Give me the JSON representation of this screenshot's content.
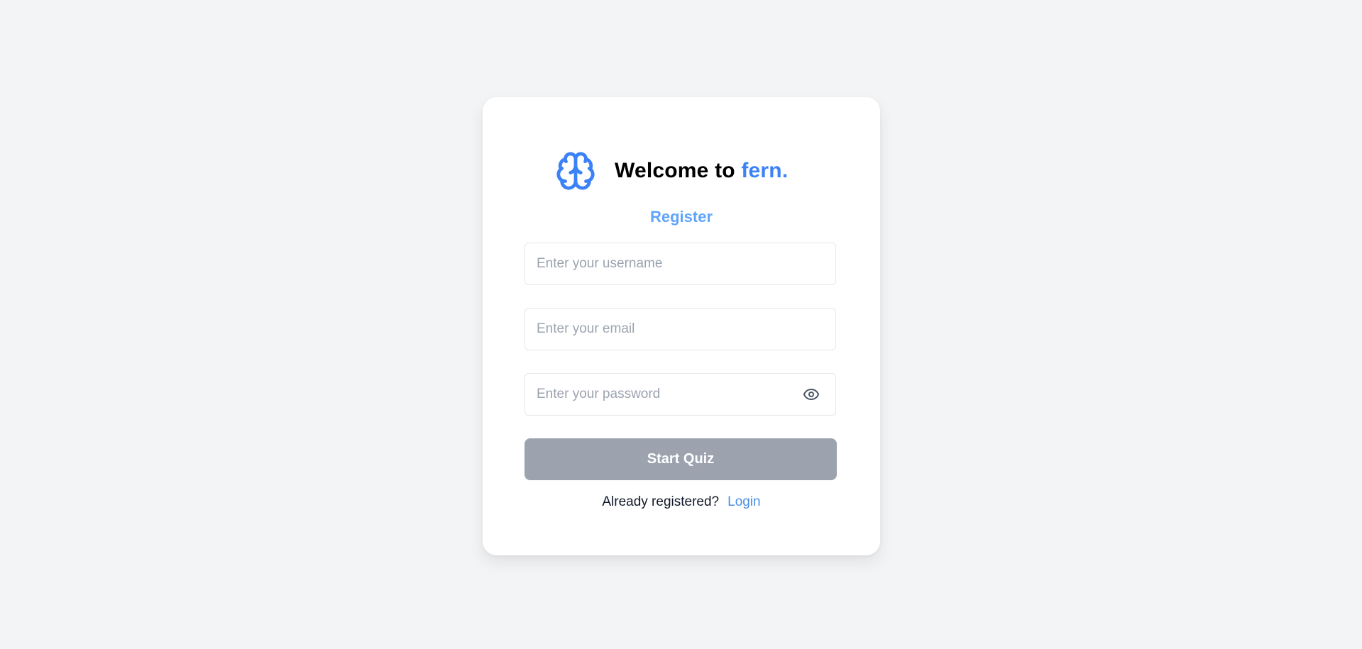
{
  "brand": {
    "welcome_prefix": "Welcome to ",
    "name": "fern.",
    "logo_icon": "brain-icon",
    "accent_color": "#3b82f6"
  },
  "form": {
    "title": "Register",
    "username_placeholder": "Enter your username",
    "email_placeholder": "Enter your email",
    "password_placeholder": "Enter your password",
    "password_toggle_icon": "eye-icon",
    "submit_label": "Start Quiz",
    "submit_color": "#9ca3af"
  },
  "footer": {
    "question": "Already registered?",
    "login_label": "Login"
  }
}
